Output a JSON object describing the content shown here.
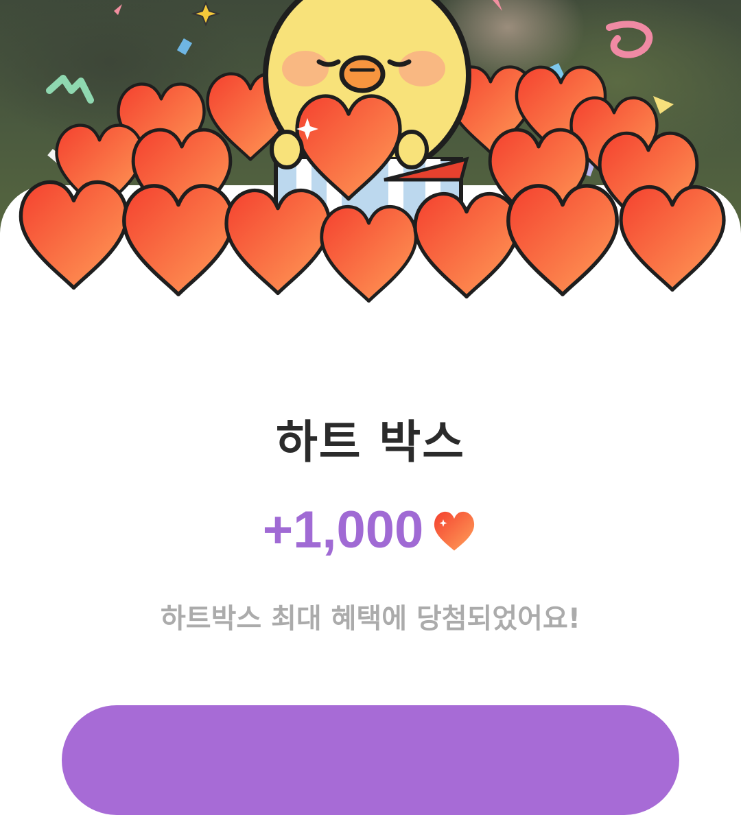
{
  "colors": {
    "accent": "#a76bd6",
    "amount": "#a06ad4",
    "title": "#2b2b2b",
    "subtitle": "#ababab",
    "heart": "#f15a3c"
  },
  "reward": {
    "title": "하트 박스",
    "amount": "+1,000",
    "amount_icon": "heart-icon",
    "message": "하트박스 최대 혜택에 당첨되었어요!"
  },
  "illustration": {
    "subject": "chick-character-icon",
    "elements": [
      "heart-pile",
      "gift-box",
      "confetti"
    ]
  },
  "cta_button": {
    "label": ""
  }
}
